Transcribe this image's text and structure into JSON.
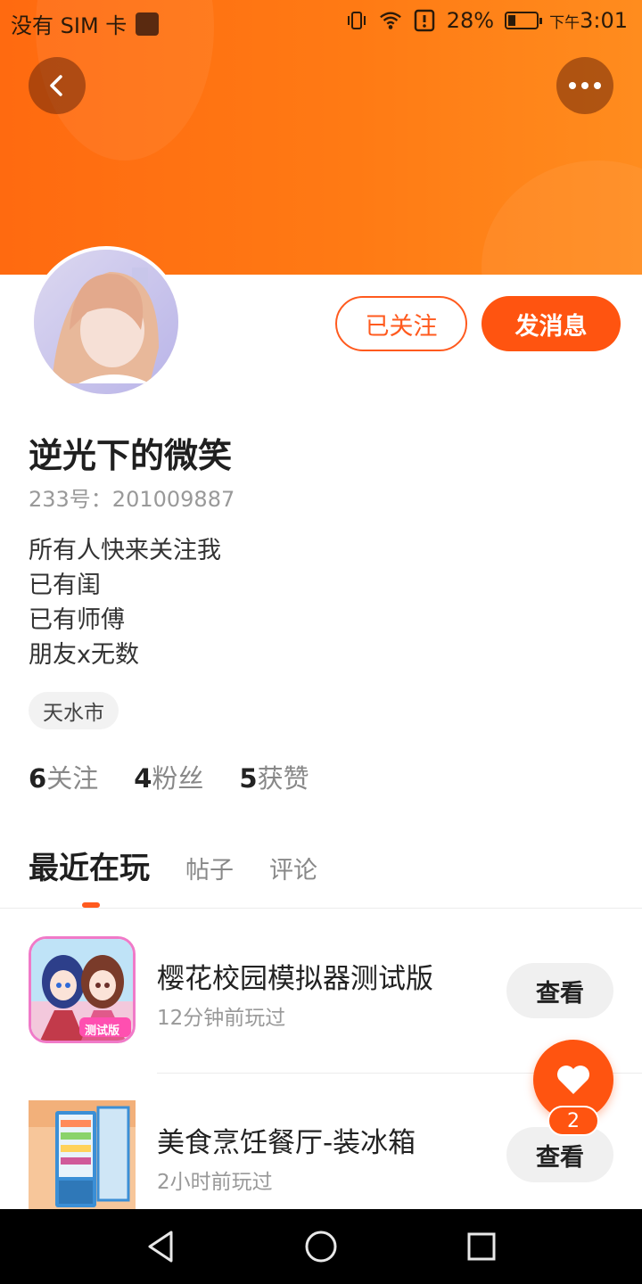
{
  "status_bar": {
    "carrier": "没有 SIM 卡",
    "battery_percent_label": "28%",
    "battery_level": 0.28,
    "time_prefix": "下午",
    "time": "3:01",
    "icons": [
      "vibrate-icon",
      "wifi-icon",
      "alert-icon",
      "battery-icon"
    ]
  },
  "header": {
    "back_icon": "chevron-left-icon",
    "more_icon": "more-dots-icon",
    "accent_color": "#ff6a10"
  },
  "profile": {
    "follow_label": "已关注",
    "message_label": "发消息",
    "username": "逆光下的微笑",
    "uid": "233号：201009887",
    "bio": [
      "所有人快来关注我",
      "已有闺",
      "已有师傅",
      "朋友x无数"
    ],
    "location": "天水市",
    "stats": [
      {
        "count": "6",
        "label": "关注"
      },
      {
        "count": "4",
        "label": "粉丝"
      },
      {
        "count": "5",
        "label": "获赞"
      }
    ]
  },
  "tabs": [
    {
      "label": "最近在玩",
      "active": true
    },
    {
      "label": "帖子",
      "active": false
    },
    {
      "label": "评论",
      "active": false
    }
  ],
  "games": [
    {
      "title": "樱花校园模拟器测试版",
      "time": "12分钟前玩过",
      "action": "查看",
      "icon_badge": "测试版"
    },
    {
      "title": "美食烹饪餐厅-装冰箱",
      "time": "2小时前玩过",
      "action": "查看"
    }
  ],
  "fab": {
    "icon": "heart-icon",
    "badge": "2"
  },
  "nav": {
    "icons": [
      "back-triangle-icon",
      "home-circle-icon",
      "recents-square-icon"
    ]
  }
}
